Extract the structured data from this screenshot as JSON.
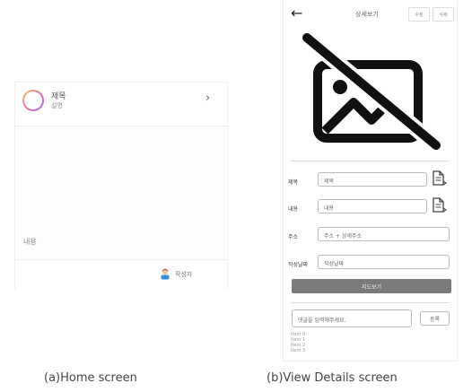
{
  "home": {
    "title": "제목",
    "subtitle": "설명",
    "content_label": "내용",
    "author": "작성자",
    "chevron_glyph": "›",
    "caption": "(a)Home screen"
  },
  "detail": {
    "back_glyph": "←",
    "title": "상세보기",
    "edit_button": "수정",
    "delete_button": "삭제",
    "image_icon": "no-image-icon",
    "fields": [
      {
        "label": "제목",
        "value": "제목"
      },
      {
        "label": "내용",
        "value": "내용"
      },
      {
        "label": "주소",
        "value": "주소 + 상세주소"
      },
      {
        "label": "작성날짜",
        "value": "작성날짜"
      }
    ],
    "submit_button": "지도보기",
    "comment_placeholder": "댓글을 입력해주세요.",
    "comment_button": "등록",
    "comments": [
      "Item 0",
      "Item 1",
      "Item 2",
      "Item 3"
    ],
    "caption": "(b)View Details screen"
  }
}
